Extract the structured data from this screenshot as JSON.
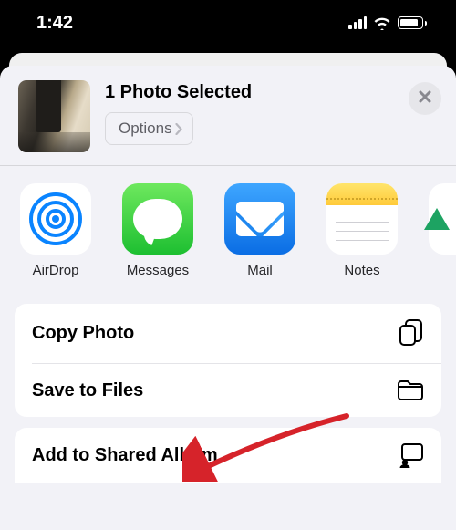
{
  "status_bar": {
    "time": "1:42"
  },
  "header": {
    "title": "1 Photo Selected",
    "options_label": "Options"
  },
  "apps": [
    {
      "id": "airdrop",
      "label": "AirDrop"
    },
    {
      "id": "messages",
      "label": "Messages"
    },
    {
      "id": "mail",
      "label": "Mail"
    },
    {
      "id": "notes",
      "label": "Notes"
    }
  ],
  "actions": {
    "group1": [
      {
        "id": "copy-photo",
        "label": "Copy Photo",
        "icon": "copy"
      },
      {
        "id": "save-to-files",
        "label": "Save to Files",
        "icon": "folder"
      }
    ],
    "group2": [
      {
        "id": "add-to-shared-album",
        "label": "Add to Shared Album",
        "icon": "shared-album"
      }
    ]
  },
  "annotation": {
    "arrow_target": "save-to-files"
  }
}
